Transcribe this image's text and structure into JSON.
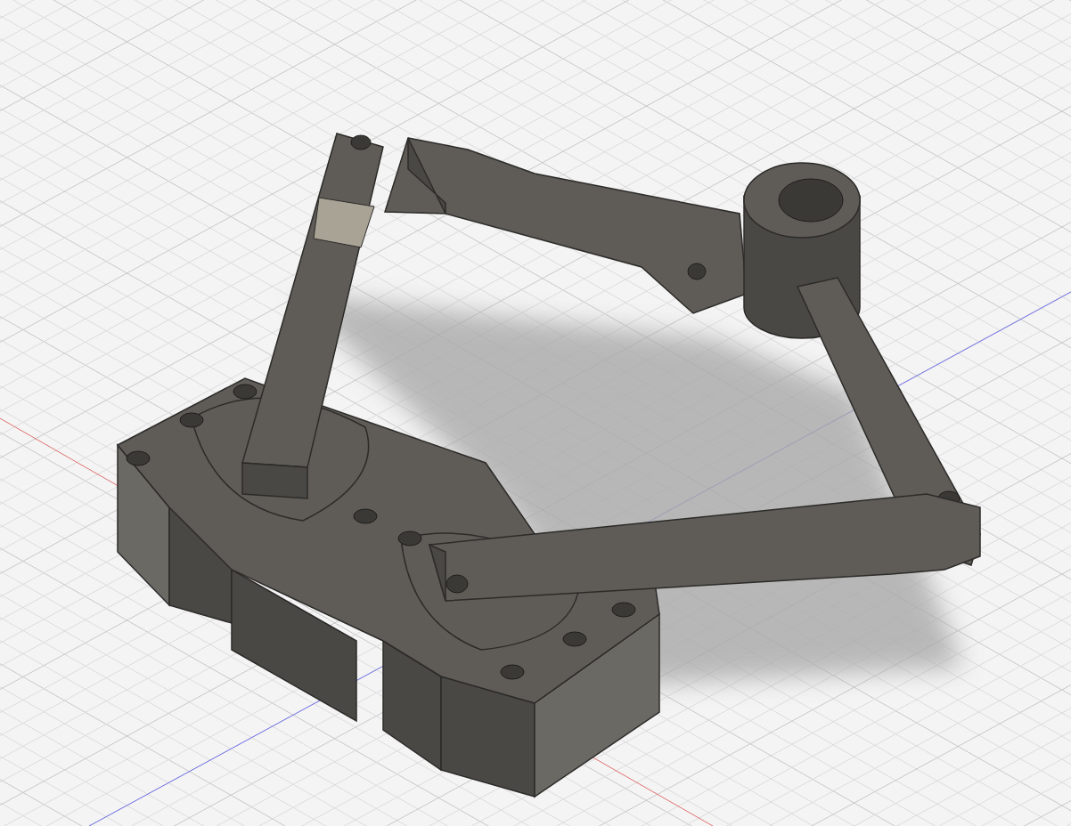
{
  "viewport": {
    "grid": true,
    "axes": true,
    "model_shadow": true
  }
}
